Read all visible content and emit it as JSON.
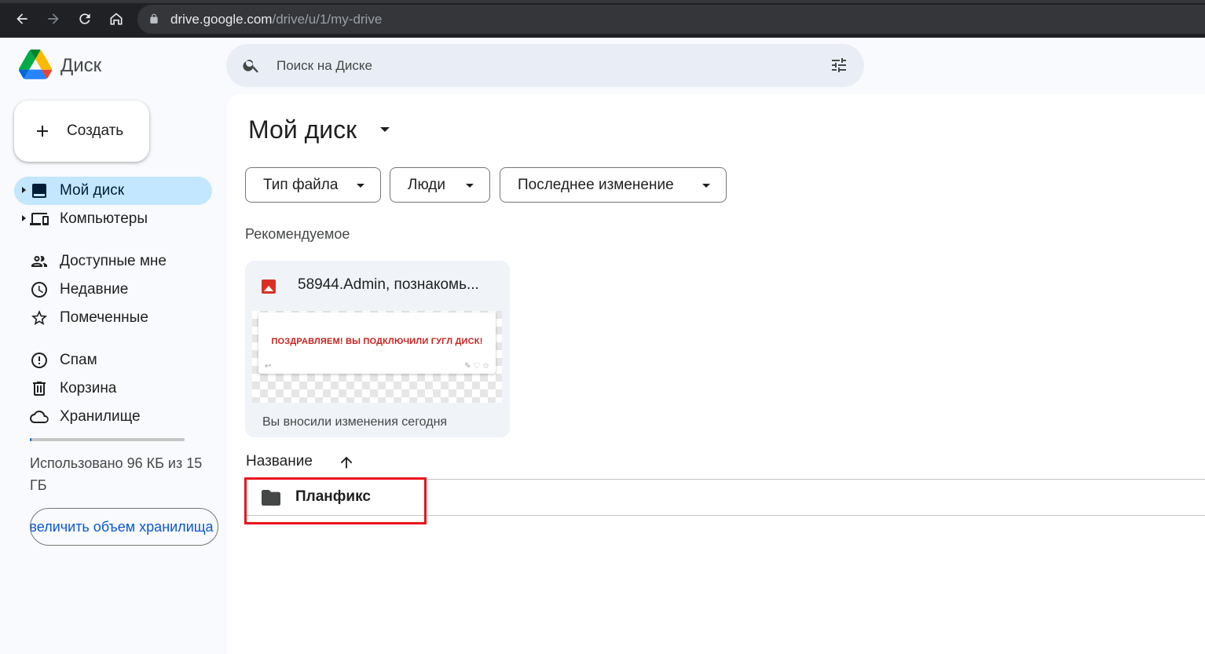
{
  "browser": {
    "url_host": "drive.google.com",
    "url_path": "/drive/u/1/my-drive",
    "icons": [
      "back-icon",
      "forward-icon",
      "reload-icon",
      "home-icon",
      "lock-icon"
    ]
  },
  "app": {
    "name": "Диск",
    "logo": "google-drive-logo"
  },
  "search": {
    "placeholder": "Поиск на Диске"
  },
  "sidebar": {
    "create_label": "Создать",
    "items": [
      {
        "label": "Мой диск",
        "icon": "my-drive-icon",
        "active": true,
        "expandable": true
      },
      {
        "label": "Компьютеры",
        "icon": "computers-icon",
        "active": false,
        "expandable": true
      },
      {
        "label": "Доступные мне",
        "icon": "shared-icon",
        "active": false
      },
      {
        "label": "Недавние",
        "icon": "clock-icon",
        "active": false
      },
      {
        "label": "Помеченные",
        "icon": "star-icon",
        "active": false
      },
      {
        "label": "Спам",
        "icon": "spam-icon",
        "active": false
      },
      {
        "label": "Корзина",
        "icon": "trash-icon",
        "active": false
      },
      {
        "label": "Хранилище",
        "icon": "cloud-icon",
        "active": false
      }
    ],
    "storage": {
      "used_fraction": 0.01,
      "text": "Использовано 96 КБ из 15 ГБ",
      "button_label": "Увеличить объем хранилища"
    }
  },
  "main": {
    "title": "Мой диск",
    "filters": [
      "Тип файла",
      "Люди",
      "Последнее изменение"
    ],
    "suggested_title": "Рекомендуемое",
    "suggested_file": {
      "name": "58944.Admin, познакомь...",
      "preview_text": "ПОЗДРАВЛЯЕМ! ВЫ ПОДКЛЮЧИЛИ ГУГЛ ДИСК!",
      "footer": "Вы вносили изменения сегодня"
    },
    "column_name": "Название",
    "rows": [
      {
        "name": "Планфикс",
        "type": "folder"
      }
    ]
  },
  "colors": {
    "accent": "#0b57d0",
    "active_nav": "#c2e7ff",
    "highlight": "#e8141b"
  }
}
